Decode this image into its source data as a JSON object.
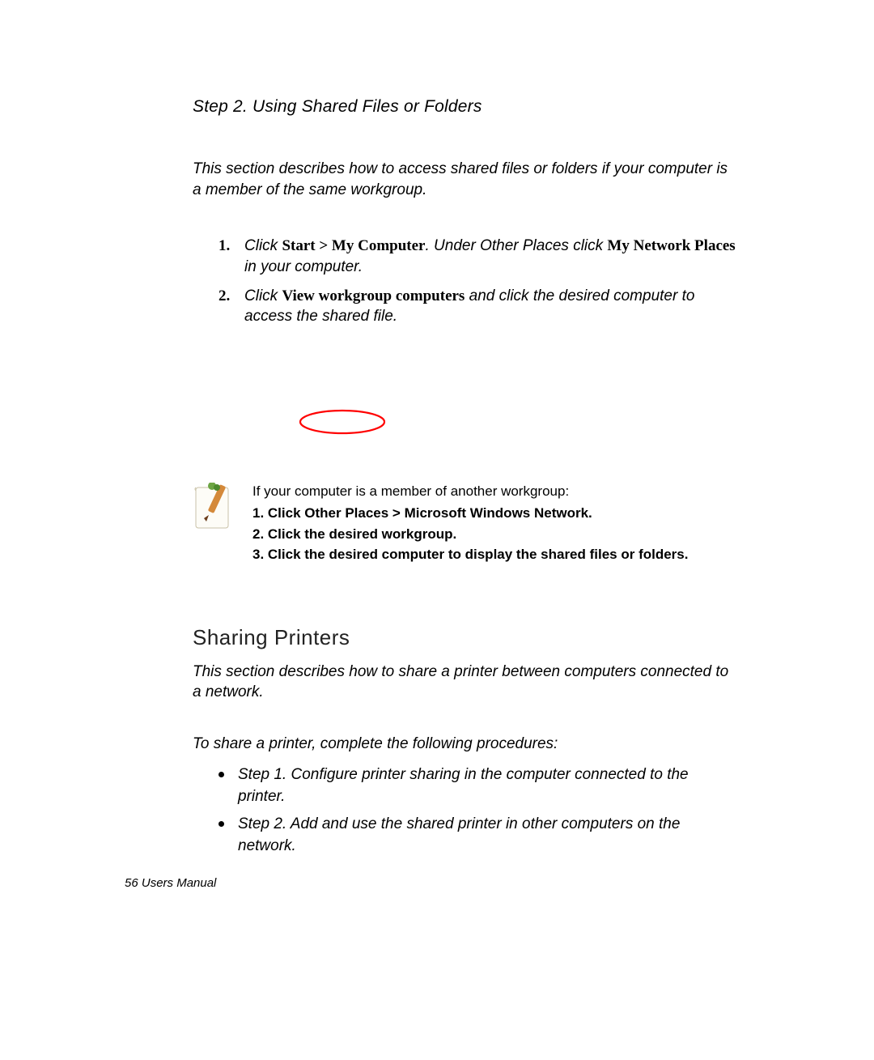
{
  "step": {
    "title": "Step 2. Using Shared Files or Folders",
    "intro": "This section describes how to access shared files or folders if your computer is a member of the same workgroup.",
    "list": [
      {
        "num": "1.",
        "p1": "Click ",
        "b1": "Start > My Computer",
        "p2": ". Under Other Places click ",
        "b2": "My Network Places",
        "p3": " in your computer."
      },
      {
        "num": "2.",
        "p1": "Click ",
        "b1": "View workgroup computers",
        "p2": " and click the desired computer to access the shared file."
      }
    ]
  },
  "note": {
    "intro": "If your computer is a member of another workgroup:",
    "lines": [
      "1. Click Other Places > Microsoft Windows Network.",
      "2. Click the desired workgroup.",
      "3. Click the desired computer to display the shared files or folders."
    ]
  },
  "printers": {
    "heading": "Sharing Printers",
    "intro": "This section describes how to share a printer between computers connected to a network.",
    "lead": "To share a printer, complete the following procedures:",
    "bullets": [
      "Step 1. Configure printer sharing in the computer connected to the printer.",
      "Step 2. Add and use the shared printer in other computers on the network."
    ]
  },
  "footer": {
    "page": "56",
    "label": "  Users Manual"
  }
}
